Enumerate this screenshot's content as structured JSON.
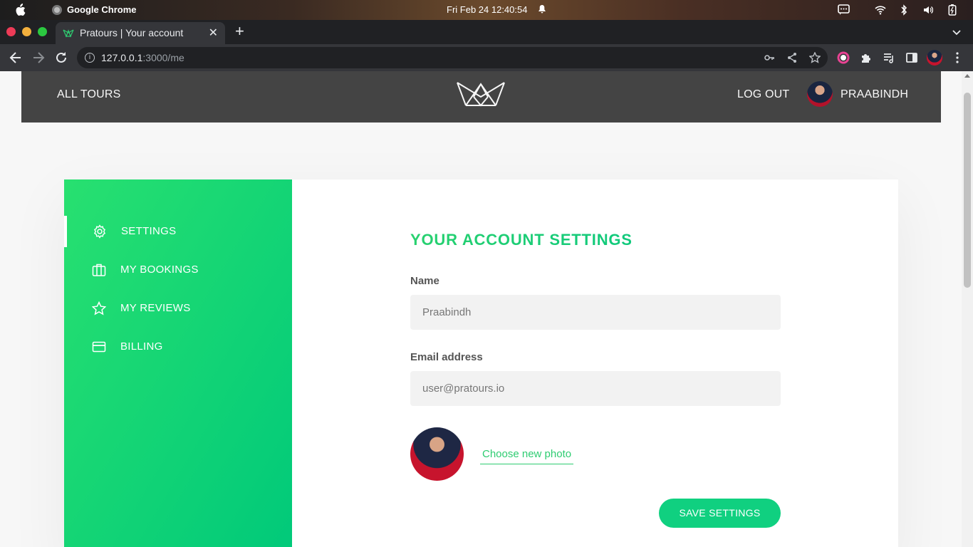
{
  "os": {
    "app_name": "Google Chrome",
    "clock": "Fri Feb 24  12:40:54"
  },
  "browser": {
    "tab_title": "Pratours | Your account",
    "tab_close": "✕",
    "new_tab": "+",
    "url_host": "127.0.0.1",
    "url_path": ":3000/me"
  },
  "header": {
    "all_tours": "ALL TOURS",
    "log_out": "LOG OUT",
    "user_name": "PRAABINDH"
  },
  "sidebar": {
    "items": [
      {
        "label": "SETTINGS",
        "icon": "settings-icon",
        "active": true
      },
      {
        "label": "MY BOOKINGS",
        "icon": "briefcase-icon",
        "active": false
      },
      {
        "label": "MY REVIEWS",
        "icon": "star-icon",
        "active": false
      },
      {
        "label": "BILLING",
        "icon": "credit-card-icon",
        "active": false
      }
    ]
  },
  "account": {
    "heading": "YOUR ACCOUNT SETTINGS",
    "name_label": "Name",
    "name_value": "Praabindh",
    "email_label": "Email address",
    "email_value": "user@pratours.io",
    "choose_photo": "Choose new photo",
    "save_button": "SAVE SETTINGS"
  },
  "colors": {
    "accent": "#2ecc71",
    "sidebar_start": "#28e070",
    "sidebar_end": "#00c97a",
    "header_bg": "#444444"
  }
}
